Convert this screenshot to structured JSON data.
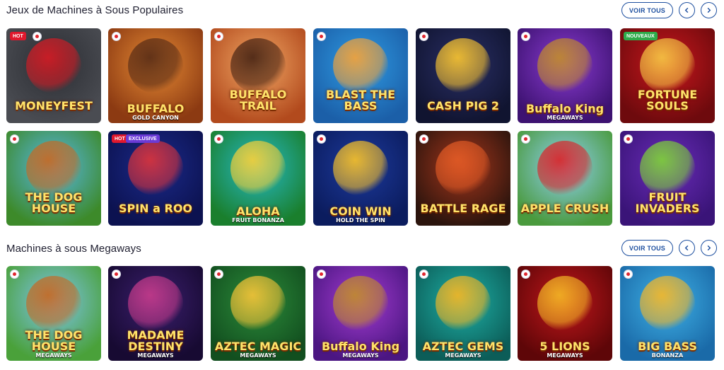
{
  "sections": [
    {
      "title": "Jeux de Machines à Sous Populaires",
      "view_all": "VOIR TOUS",
      "rows": [
        [
          {
            "name": "MONEYFEST",
            "sub": "",
            "badge": "HOT",
            "bg": [
              "#2b2d33",
              "#4a4c52"
            ],
            "accent": "#d21c25"
          },
          {
            "name": "BUFFALO",
            "sub": "GOLD CANYON",
            "badge": "",
            "bg": [
              "#e58a34",
              "#8c3a12"
            ],
            "accent": "#5a2d16"
          },
          {
            "name": "BUFFALO TRAIL",
            "sub": "",
            "badge": "",
            "bg": [
              "#f1a865",
              "#b24a1d"
            ],
            "accent": "#4a2514"
          },
          {
            "name": "BLAST THE BASS",
            "sub": "",
            "badge": "",
            "bg": [
              "#2f9be3",
              "#1b5fa8"
            ],
            "accent": "#f2a23a"
          },
          {
            "name": "CASH PIG 2",
            "sub": "",
            "badge": "",
            "bg": [
              "#2a2f66",
              "#101430"
            ],
            "accent": "#f6c230"
          },
          {
            "name": "Buffalo King",
            "sub": "MEGAWAYS",
            "badge": "",
            "bg": [
              "#8a3bd1",
              "#3d1271"
            ],
            "accent": "#c08a2e"
          },
          {
            "name": "FORTUNE SOULS",
            "sub": "",
            "badge": "NOUVEAUX",
            "bg": [
              "#c8171d",
              "#6e0a0d"
            ],
            "accent": "#f5c443"
          }
        ],
        [
          {
            "name": "THE DOG HOUSE",
            "sub": "",
            "badge": "",
            "bg": [
              "#57b7e8",
              "#3d8a2a"
            ],
            "accent": "#c46a24"
          },
          {
            "name": "SPIN a ROO",
            "sub": "",
            "badge": "HOT|EXCLUSIVE",
            "bg": [
              "#1b2a8a",
              "#0c1250"
            ],
            "accent": "#d9333c"
          },
          {
            "name": "ALOHA",
            "sub": "FRUIT BONANZA",
            "badge": "",
            "bg": [
              "#26b9c7",
              "#1a7f2d"
            ],
            "accent": "#f3cf3a"
          },
          {
            "name": "COIN WIN",
            "sub": "HOLD THE SPIN",
            "badge": "",
            "bg": [
              "#1d3a9c",
              "#0b1c5e"
            ],
            "accent": "#f5c02a"
          },
          {
            "name": "BATTLE RAGE",
            "sub": "",
            "badge": "",
            "bg": [
              "#a5361c",
              "#2b140d"
            ],
            "accent": "#e05a25"
          },
          {
            "name": "APPLE CRUSH",
            "sub": "",
            "badge": "",
            "bg": [
              "#8fd0f2",
              "#4a9a3d"
            ],
            "accent": "#d8262a"
          },
          {
            "name": "FRUIT INVADERS",
            "sub": "",
            "badge": "",
            "bg": [
              "#6a2cb8",
              "#3a1478"
            ],
            "accent": "#7ed03a"
          }
        ]
      ]
    },
    {
      "title": "Machines à sous Megaways",
      "view_all": "VOIR TOUS",
      "rows": [
        [
          {
            "name": "THE DOG HOUSE",
            "sub": "MEGAWAYS",
            "badge": "",
            "bg": [
              "#7ec4ee",
              "#4aa13a"
            ],
            "accent": "#c46a24"
          },
          {
            "name": "MADAME DESTINY",
            "sub": "MEGAWAYS",
            "badge": "",
            "bg": [
              "#3b1f6e",
              "#170a32"
            ],
            "accent": "#c33a8a"
          },
          {
            "name": "AZTEC MAGIC",
            "sub": "MEGAWAYS",
            "badge": "",
            "bg": [
              "#2c8b3a",
              "#124f1f"
            ],
            "accent": "#f2c237"
          },
          {
            "name": "Buffalo King",
            "sub": "MEGAWAYS",
            "badge": "",
            "bg": [
              "#a33cd0",
              "#4b1682"
            ],
            "accent": "#c08a2e"
          },
          {
            "name": "AZTEC GEMS",
            "sub": "MEGAWAYS",
            "badge": "",
            "bg": [
              "#1eb0a6",
              "#0c5d58"
            ],
            "accent": "#f2b524"
          },
          {
            "name": "5 LIONS",
            "sub": "MEGAWAYS",
            "badge": "",
            "bg": [
              "#c2171b",
              "#5e0608"
            ],
            "accent": "#f2b424"
          },
          {
            "name": "BIG BASS",
            "sub": "BONANZA",
            "badge": "",
            "bg": [
              "#3fb1e6",
              "#1a6aa8"
            ],
            "accent": "#f3b72a"
          }
        ]
      ]
    }
  ]
}
